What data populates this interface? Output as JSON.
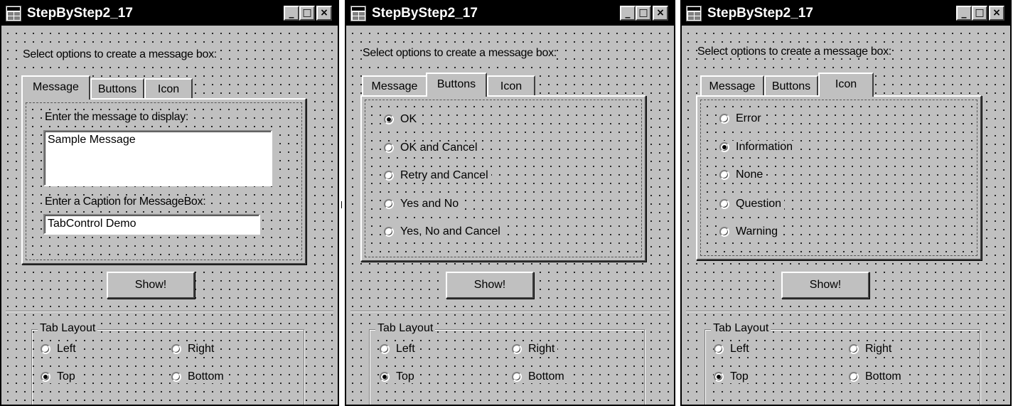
{
  "window": {
    "title": "StepByStep2_17",
    "minimize_glyph": "_",
    "maximize_glyph": "□",
    "close_glyph": "×"
  },
  "prompt": "Select options to create  a message box:",
  "tabs": [
    "Message",
    "Buttons",
    "Icon"
  ],
  "message_tab": {
    "message_label": "Enter the message to display:",
    "message_value": "Sample Message",
    "caption_label": "Enter a Caption for MessageBox:",
    "caption_value": "TabControl Demo"
  },
  "buttons_tab": {
    "options": [
      "OK",
      "OK and Cancel",
      "Retry and Cancel",
      "Yes and No",
      "Yes, No and Cancel"
    ],
    "selected": "OK"
  },
  "icon_tab": {
    "options": [
      "Error",
      "Information",
      "None",
      "Question",
      "Warning"
    ],
    "selected": "Information"
  },
  "show_button": "Show!",
  "tab_layout": {
    "legend": "Tab Layout",
    "options": [
      "Left",
      "Right",
      "Top",
      "Bottom"
    ],
    "selected": "Top"
  },
  "screens": [
    {
      "active_tab": "Message"
    },
    {
      "active_tab": "Buttons"
    },
    {
      "active_tab": "Icon"
    }
  ]
}
